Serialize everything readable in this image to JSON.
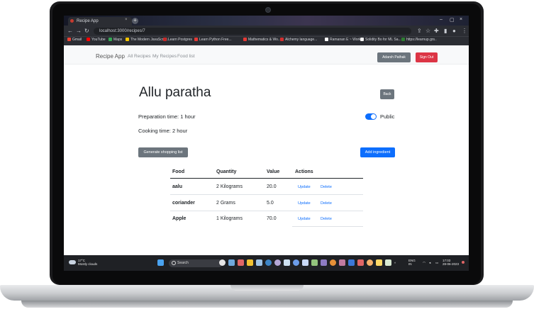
{
  "browser": {
    "tab_title": "Recipe App",
    "url": "localhost:3000/recipes/7",
    "bookmarks": [
      "Gmail",
      "YouTube",
      "Maps",
      "The Modern JavaScript...",
      "Learn Postgres",
      "Learn Python Free...",
      "Mathematics & Wo...",
      "Alchemy language...",
      "Ramanan E ~ Work...",
      "Solidity Bo for ML Sa...",
      "https://learnup.grs.."
    ],
    "bookmark_colors": [
      "#ea4335",
      "#ff0000",
      "#34a853",
      "#f7c600",
      "#c62828",
      "#e53935",
      "#e53935",
      "#d32f2f",
      "#ffffff",
      "#f5f5f5",
      "#2e7d32"
    ]
  },
  "app_nav": {
    "brand": "Recipe App",
    "links": [
      "All Recipes",
      "My Recipes",
      "Food list"
    ],
    "user_button": "Adarsh Pathak",
    "signout_button": "Sign Out"
  },
  "recipe": {
    "title": "Allu paratha",
    "back_button": "Back",
    "preparation_label": "Preparation time:",
    "preparation_value": "1 hour",
    "cooking_label": "Cooking time:",
    "cooking_value": "2 hour",
    "public_label": "Public",
    "public_on": true,
    "shopping_button": "Generate shopping list",
    "add_button": "Add ingredient"
  },
  "table": {
    "headers": [
      "Food",
      "Quantity",
      "Value",
      "Actions"
    ],
    "rows": [
      {
        "food": "aalu",
        "quantity": "2 Kilograms",
        "value": "20.0",
        "update": "Update",
        "delete": "Delete"
      },
      {
        "food": "coriander",
        "quantity": "2 Grams",
        "value": "5.0",
        "update": "Update",
        "delete": "Delete"
      },
      {
        "food": "Apple",
        "quantity": "1 Kilograms",
        "value": "70.0",
        "update": "Update",
        "delete": "Delete"
      }
    ]
  },
  "taskbar": {
    "weather_temp": "17°C",
    "weather_desc": "Mostly clouds",
    "search": "Search",
    "lang": "ENG",
    "region": "IN",
    "time": "17:03",
    "date": "28-06-2023"
  },
  "colors": {
    "primary": "#0d6efd",
    "secondary": "#6c757d",
    "danger": "#dc3545"
  }
}
